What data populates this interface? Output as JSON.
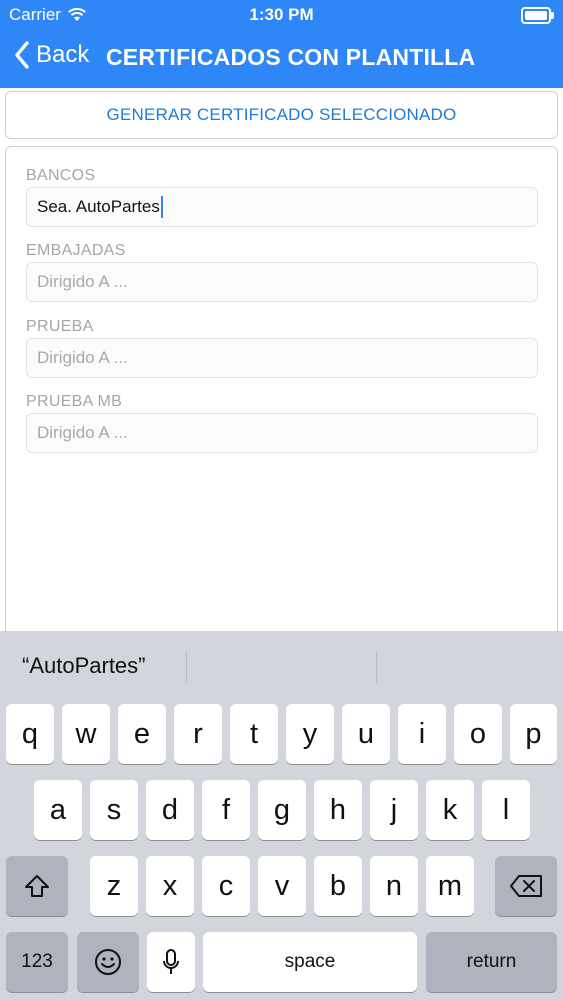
{
  "status_bar": {
    "carrier": "Carrier",
    "time": "1:30 PM"
  },
  "nav": {
    "back_label": "Back",
    "title": "CERTIFICADOS CON PLANTILLA"
  },
  "generate_button_label": "GENERAR CERTIFICADO SELECCIONADO",
  "fields": [
    {
      "label": "BANCOS",
      "value": "Sea. AutoPartes",
      "placeholder": ""
    },
    {
      "label": "EMBAJADAS",
      "value": "",
      "placeholder": "Dirigido A ..."
    },
    {
      "label": "PRUEBA",
      "value": "",
      "placeholder": "Dirigido A ..."
    },
    {
      "label": "PRUEBA MB",
      "value": "",
      "placeholder": "Dirigido A ..."
    }
  ],
  "keyboard": {
    "prediction": "“AutoPartes”",
    "row1": [
      "q",
      "w",
      "e",
      "r",
      "t",
      "y",
      "u",
      "i",
      "o",
      "p"
    ],
    "row2": [
      "a",
      "s",
      "d",
      "f",
      "g",
      "h",
      "j",
      "k",
      "l"
    ],
    "row3": [
      "z",
      "x",
      "c",
      "v",
      "b",
      "n",
      "m"
    ],
    "numbers_label": "123",
    "space_label": "space",
    "return_label": "return"
  },
  "colors": {
    "nav_blue": "#2f86f6",
    "button_text_blue": "#1f7bd8",
    "keyboard_bg": "#d2d5db"
  }
}
